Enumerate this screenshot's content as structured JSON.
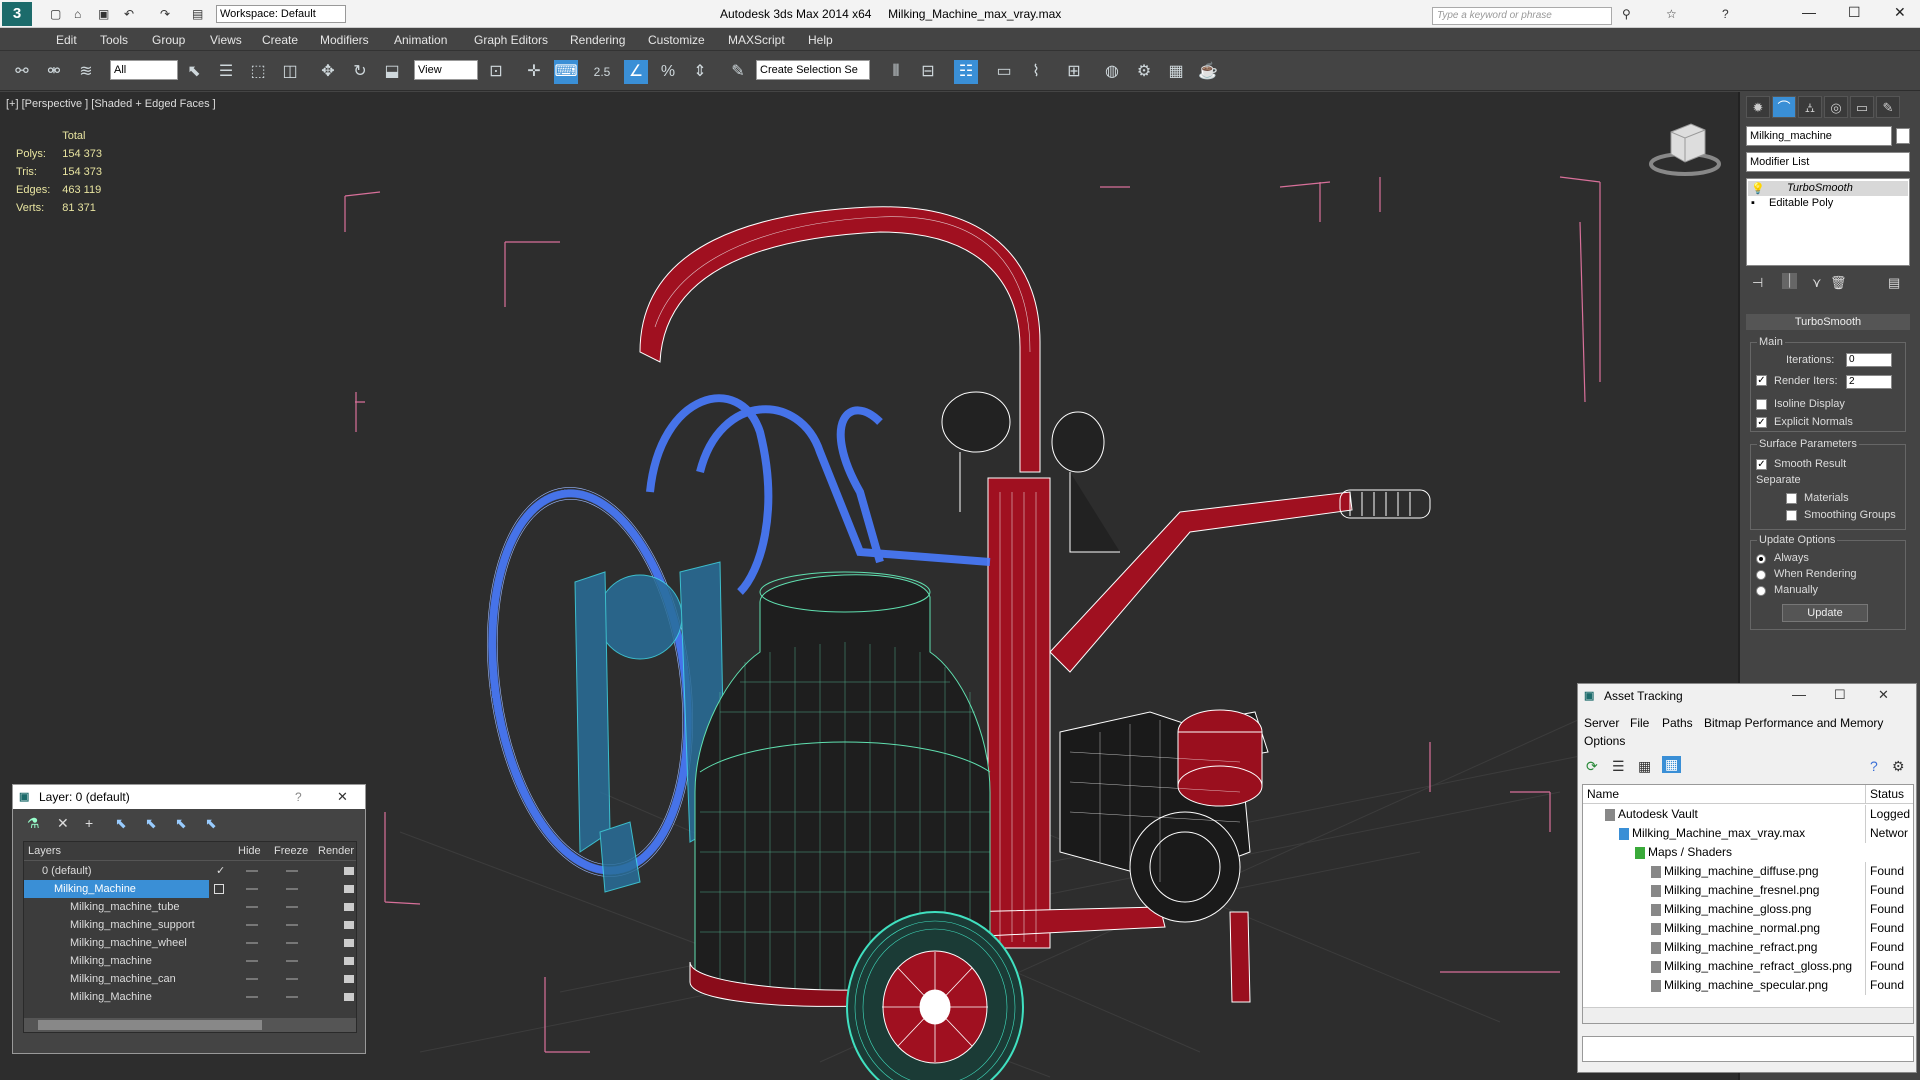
{
  "titlebar": {
    "workspace": "Workspace: Default",
    "app_name": "Autodesk 3ds Max  2014 x64",
    "file_name": "Milking_Machine_max_vray.max",
    "search_placeholder": "Type a keyword or phrase"
  },
  "menu": [
    "Edit",
    "Tools",
    "Group",
    "Views",
    "Create",
    "Modifiers",
    "Animation",
    "Graph Editors",
    "Rendering",
    "Customize",
    "MAXScript",
    "Help"
  ],
  "toolbar": {
    "selection_filter": "All",
    "ref_coord": "View",
    "snap_value": "2.5",
    "named_selection": "Create Selection Se"
  },
  "viewport": {
    "label": "[+] [Perspective ] [Shaded + Edged Faces ]",
    "stats_header": "Total",
    "stats": [
      {
        "label": "Polys:",
        "value": "154 373"
      },
      {
        "label": "Tris:",
        "value": "154 373"
      },
      {
        "label": "Edges:",
        "value": "463 119"
      },
      {
        "label": "Verts:",
        "value": "81 371"
      }
    ]
  },
  "command_panel": {
    "object_name": "Milking_machine",
    "modifier_list": "Modifier List",
    "stack": [
      "TurboSmooth",
      "Editable Poly"
    ],
    "rollout_title": "TurboSmooth",
    "main_group": "Main",
    "iterations_label": "Iterations:",
    "iterations_value": "0",
    "render_iters_label": "Render Iters:",
    "render_iters_value": "2",
    "isoline_label": "Isoline Display",
    "explicit_normals_label": "Explicit Normals",
    "surface_group": "Surface Parameters",
    "smooth_result_label": "Smooth Result",
    "separate_label": "Separate",
    "materials_label": "Materials",
    "smoothing_groups_label": "Smoothing Groups",
    "update_group": "Update Options",
    "always_label": "Always",
    "when_rendering_label": "When Rendering",
    "manually_label": "Manually",
    "update_button": "Update"
  },
  "layer_window": {
    "title": "Layer: 0 (default)",
    "help": "?",
    "col_layers": "Layers",
    "col_hide": "Hide",
    "col_freeze": "Freeze",
    "col_render": "Render",
    "rows": [
      {
        "name": "0 (default)",
        "indent": 0
      },
      {
        "name": "Milking_Machine",
        "indent": 0,
        "selected": true
      },
      {
        "name": "Milking_machine_tube",
        "indent": 1
      },
      {
        "name": "Milking_machine_support",
        "indent": 1
      },
      {
        "name": "Milking_machine_wheel",
        "indent": 1
      },
      {
        "name": "Milking_machine",
        "indent": 1
      },
      {
        "name": "Milking_machine_can",
        "indent": 1
      },
      {
        "name": "Milking_Machine",
        "indent": 1
      }
    ]
  },
  "asset_window": {
    "title": "Asset Tracking",
    "menu": [
      "Server",
      "File",
      "Paths",
      "Bitmap Performance and Memory",
      "Options"
    ],
    "col_name": "Name",
    "col_status": "Status",
    "rows": [
      {
        "name": "Autodesk Vault",
        "status": "Logged",
        "indent": 1
      },
      {
        "name": "Milking_Machine_max_vray.max",
        "status": "Networ",
        "indent": 2
      },
      {
        "name": "Maps / Shaders",
        "status": "",
        "indent": 3
      },
      {
        "name": "Milking_machine_diffuse.png",
        "status": "Found",
        "indent": 4
      },
      {
        "name": "Milking_machine_fresnel.png",
        "status": "Found",
        "indent": 4
      },
      {
        "name": "Milking_machine_gloss.png",
        "status": "Found",
        "indent": 4
      },
      {
        "name": "Milking_machine_normal.png",
        "status": "Found",
        "indent": 4
      },
      {
        "name": "Milking_machine_refract.png",
        "status": "Found",
        "indent": 4
      },
      {
        "name": "Milking_machine_refract_gloss.png",
        "status": "Found",
        "indent": 4
      },
      {
        "name": "Milking_machine_specular.png",
        "status": "Found",
        "indent": 4
      }
    ]
  },
  "colors": {
    "wire_red": "#b01020",
    "wire_blue": "#4a7cff",
    "wire_cyan": "#40e0c0",
    "wire_white": "#ffffff",
    "viewport_bg": "#2d2d2d",
    "selection_blue": "#3a8fd6"
  }
}
